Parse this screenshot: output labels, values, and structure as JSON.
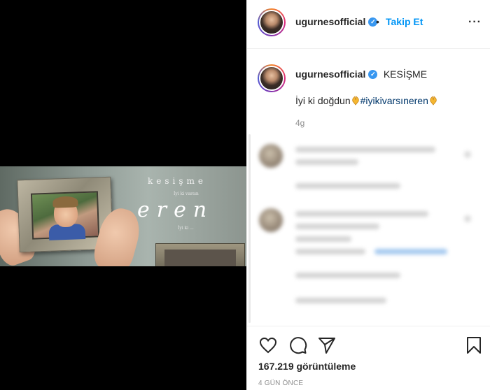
{
  "media": {
    "title_small": "kesişme",
    "title_line2": "İyi ki varsın",
    "title_big": "eren",
    "title_line3": "İyi ki ..."
  },
  "header": {
    "username": "ugurnesofficial",
    "separator": "•",
    "follow_label": "Takip Et",
    "more_label": "···"
  },
  "caption": {
    "username": "ugurnesofficial",
    "title": "KESİŞME",
    "text_before": "İyi ki doğdun",
    "hashtag": "#iyikivarsıneren",
    "time": "4g"
  },
  "stats": {
    "views": "167.219 görüntüleme",
    "date": "4 GÜN ÖNCE"
  },
  "icons": {
    "like": "heart-icon",
    "comment": "comment-icon",
    "share": "paper-plane-icon",
    "save": "bookmark-icon",
    "verified": "verified-badge-icon"
  },
  "colors": {
    "accent": "#0095f6",
    "verified": "#3897f0",
    "hashtag": "#00376b",
    "muted": "#8e8e8e"
  }
}
